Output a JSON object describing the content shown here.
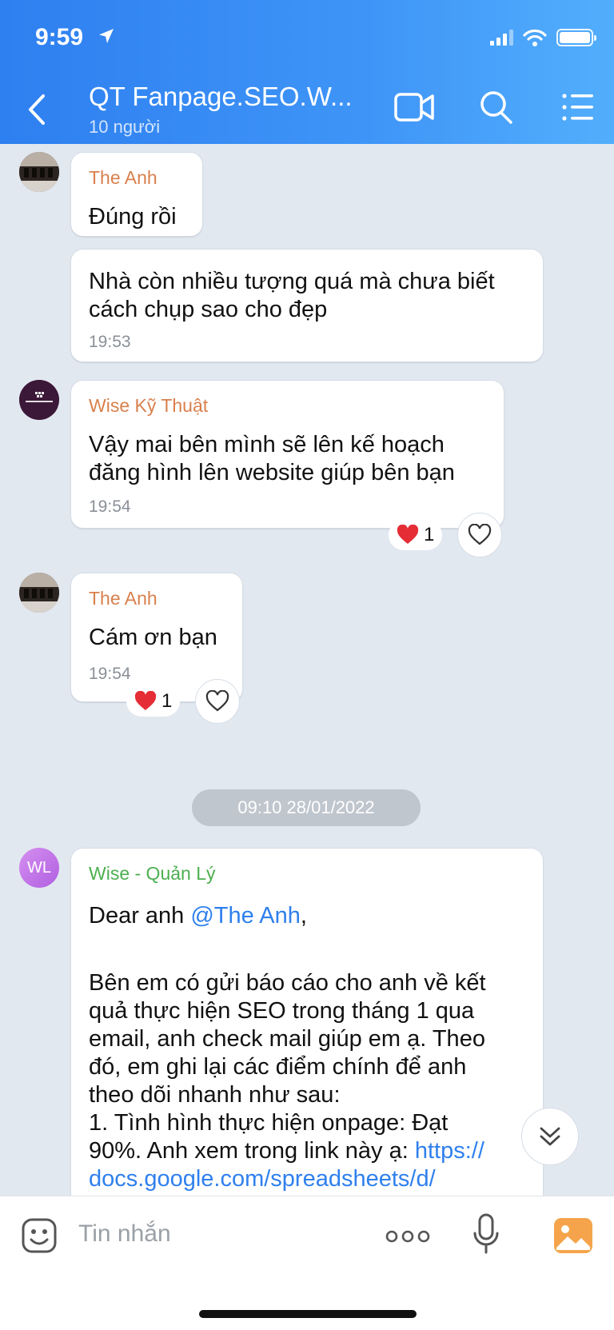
{
  "status_bar": {
    "time": "9:59"
  },
  "header": {
    "title": "QT Fanpage.SEO.W...",
    "subtitle": "10 người"
  },
  "messages": [
    {
      "sender": "The Anh",
      "text": "Đúng rồi"
    },
    {
      "text_line1": "Nhà còn nhiều tượng quá mà chưa biết",
      "text_line2": "cách chụp sao cho đẹp",
      "time": "19:53"
    },
    {
      "sender": "Wise Kỹ Thuật",
      "avatar_text": "WISE BUSINESS",
      "text_line1": "Vậy mai bên mình sẽ lên kế hoạch",
      "text_line2": "đăng hình lên website giúp bên bạn",
      "time": "19:54",
      "reaction_count": "1"
    },
    {
      "sender": "The Anh",
      "text": "Cám ơn bạn",
      "time": "19:54",
      "reaction_count": "1"
    }
  ],
  "date_separator": "09:10 28/01/2022",
  "long_message": {
    "avatar_initials": "WL",
    "sender": "Wise - Quản Lý",
    "greeting": "Dear anh ",
    "mention": "@The Anh",
    "greeting_end": ",",
    "lines": [
      "Bên em có gửi báo cáo cho anh về kết",
      "quả thực hiện SEO trong tháng 1 qua",
      "email, anh check mail giúp em ạ. Theo",
      "đó, em ghi lại các điểm chính để anh",
      "theo dõi nhanh như sau:",
      "1. Tình hình thực hiện onpage: Đạt"
    ],
    "line7_text": "90%. Anh xem trong link này ạ: ",
    "line7_link": "https://",
    "line8_link": "docs.google.com/spreadsheets/d/"
  },
  "input": {
    "placeholder": "Tin nhắn"
  },
  "colors": {
    "header_start": "#2e7ff0",
    "header_end": "#52aefc",
    "sender_orange": "#d9804d",
    "sender_green": "#4caf50",
    "link": "#2f80ed",
    "heart": "#e52d35"
  }
}
